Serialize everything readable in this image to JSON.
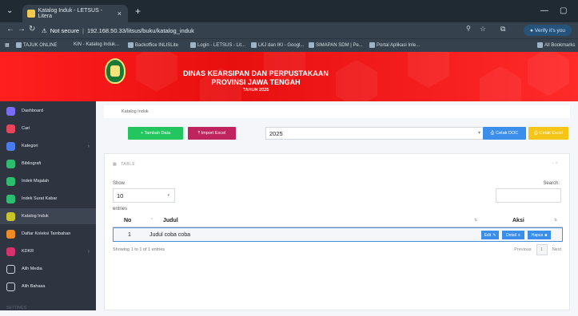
{
  "browser": {
    "tab_title": "Katalog Induk - LETSUS - Litera",
    "tab_close": "×",
    "new_tab": "+",
    "url_warning": "Not secure",
    "url": "192.168.50.33/litsus/buku/katalog_induk",
    "verify_label": "Verify it's you",
    "bookmarks": [
      "TAJUK ONLINE",
      "KIN - Katalog Induk...",
      "Backoffice INLISLite",
      "Login - LETSUS - Lit...",
      "LKJ dan IKI - Googl...",
      "SIMAPAN SDM | Pe...",
      "Portal Aplikasi Inle...",
      "All Bookmarks"
    ]
  },
  "banner": {
    "line1": "DINAS KEARSIPAN DAN PERPUSTAKAAN",
    "line2": "PROVINSI JAWA TENGAH",
    "line3": "TAHUN 2025"
  },
  "sidebar": {
    "items": [
      {
        "label": "Dashboard",
        "icon": "dashboard-icon",
        "color": "#7b6cf6"
      },
      {
        "label": "Cari",
        "icon": "search-icon",
        "color": "#e8455a"
      },
      {
        "label": "Kategori",
        "icon": "book-icon",
        "color": "#4a7cf0"
      },
      {
        "label": "Bibliografi",
        "icon": "grid-icon",
        "color": "#2dbd6e"
      },
      {
        "label": "Indek Majalah",
        "icon": "grid-icon",
        "color": "#2dbd6e"
      },
      {
        "label": "Indek Surat Kabar",
        "icon": "grid-icon",
        "color": "#2dbd6e"
      },
      {
        "label": "Katalog Induk",
        "icon": "grid-icon",
        "color": "#c9c42a"
      },
      {
        "label": "Daftar Koleksi Tambahan",
        "icon": "grid-icon",
        "color": "#f08a24"
      },
      {
        "label": "KDKR",
        "icon": "grid-icon",
        "color": "#d6336c"
      },
      {
        "label": "Alih Media",
        "icon": "grid-icon",
        "color": "none"
      },
      {
        "label": "Alih Bahasa",
        "icon": "grid-icon",
        "color": "none"
      }
    ],
    "footer": "SETTINGS"
  },
  "main": {
    "breadcrumb": "Katalog Induk",
    "btn_tambah": "+ Tambah Data",
    "btn_import": "⤒ Import Excel",
    "year_value": "2025",
    "btn_cetak_doc": "Cetak DOC",
    "btn_cetak_excel": "Cetak Excel",
    "card_title": "TABLE",
    "show_label": "Show",
    "length_value": "10",
    "entries_label": "entries",
    "search_label": "Search:",
    "columns": [
      "No",
      "Judul",
      "Aksi"
    ],
    "rows": [
      {
        "no": "1",
        "judul": "Judul coba coba",
        "edit": "Edit",
        "detail": "Detail",
        "hapus": "Hapus"
      }
    ],
    "info": "Showing 1 to 1 of 1 entries",
    "prev": "Previous",
    "page": "1",
    "next": "Next"
  },
  "colors": {
    "banner_red": "#ff1f1f",
    "btn_green": "#22c55e",
    "btn_pink": "#c0245f",
    "btn_blue": "#3b8eea",
    "btn_yellow": "#f5c518",
    "sidebar_bg": "#2e3440"
  }
}
